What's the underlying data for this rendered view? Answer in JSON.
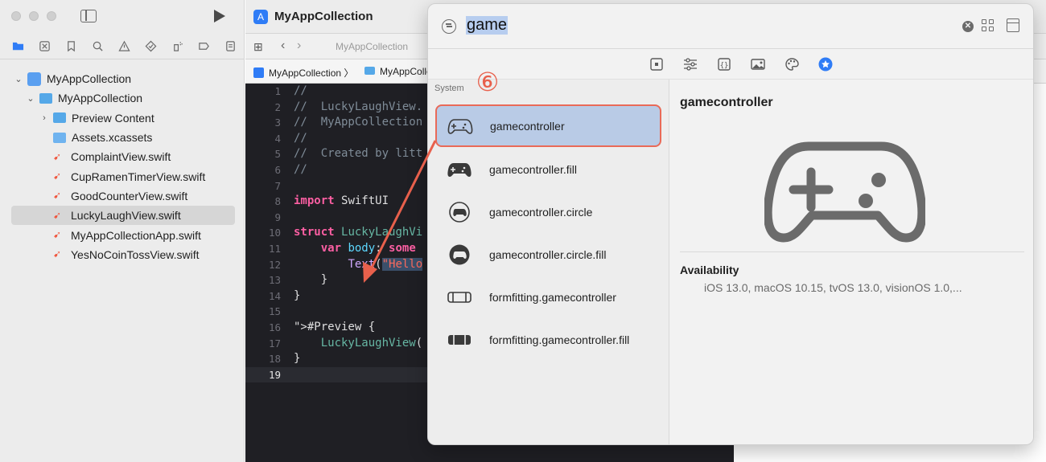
{
  "navigator": {
    "tree": [
      {
        "label": "MyAppCollection",
        "kind": "project",
        "level": 0,
        "expanded": true
      },
      {
        "label": "MyAppCollection",
        "kind": "folder",
        "level": 1,
        "expanded": true
      },
      {
        "label": "Preview Content",
        "kind": "folder",
        "level": 2,
        "expanded": false
      },
      {
        "label": "Assets.xcassets",
        "kind": "assets",
        "level": 2
      },
      {
        "label": "ComplaintView.swift",
        "kind": "swift",
        "level": 2
      },
      {
        "label": "CupRamenTimerView.swift",
        "kind": "swift",
        "level": 2
      },
      {
        "label": "GoodCounterView.swift",
        "kind": "swift",
        "level": 2
      },
      {
        "label": "LuckyLaughView.swift",
        "kind": "swift",
        "level": 2,
        "selected": true
      },
      {
        "label": "MyAppCollectionApp.swift",
        "kind": "swift",
        "level": 2
      },
      {
        "label": "YesNoCoinTossView.swift",
        "kind": "swift",
        "level": 2
      }
    ]
  },
  "editor": {
    "window_title": "MyAppCollection",
    "toolbar_crumb": "MyAppCollection",
    "jump_bar": [
      "MyAppCollection",
      "MyAppCollection"
    ],
    "lines": [
      {
        "n": "1",
        "text": "//"
      },
      {
        "n": "2",
        "text": "//  LuckyLaughView."
      },
      {
        "n": "3",
        "text": "//  MyAppCollection"
      },
      {
        "n": "4",
        "text": "//"
      },
      {
        "n": "5",
        "text": "//  Created by litt"
      },
      {
        "n": "6",
        "text": "//"
      },
      {
        "n": "7",
        "text": ""
      },
      {
        "n": "8",
        "text": "import SwiftUI"
      },
      {
        "n": "9",
        "text": ""
      },
      {
        "n": "10",
        "text": "struct LuckyLaughVi"
      },
      {
        "n": "11",
        "text": "    var body: some"
      },
      {
        "n": "12",
        "text": "        Text(\"Hello"
      },
      {
        "n": "13",
        "text": "    }"
      },
      {
        "n": "14",
        "text": "}"
      },
      {
        "n": "15",
        "text": ""
      },
      {
        "n": "16",
        "text": "#Preview {"
      },
      {
        "n": "17",
        "text": "    LuckyLaughView("
      },
      {
        "n": "18",
        "text": "}"
      },
      {
        "n": "19",
        "text": ""
      }
    ]
  },
  "library": {
    "search": {
      "value": "game",
      "placeholder": ""
    },
    "tabs": [
      "views-icon",
      "modifiers-icon",
      "snippets-icon",
      "images-icon",
      "colors-icon",
      "symbols-icon"
    ],
    "active_tab": "symbols-icon",
    "section": "System",
    "results": [
      {
        "name": "gamecontroller",
        "selected": true
      },
      {
        "name": "gamecontroller.fill"
      },
      {
        "name": "gamecontroller.circle"
      },
      {
        "name": "gamecontroller.circle.fill"
      },
      {
        "name": "formfitting.gamecontroller"
      },
      {
        "name": "formfitting.gamecontroller.fill"
      }
    ],
    "detail": {
      "title": "gamecontroller",
      "availability_label": "Availability",
      "availability_value": "iOS 13.0, macOS 10.15, tvOS 13.0, visionOS 1.0,..."
    }
  },
  "annotation": {
    "step": "⑥",
    "color": "#e8604c"
  },
  "colors": {
    "accent": "#2f7cf6",
    "selection": "#b9cbe6",
    "annotation": "#e8604c"
  }
}
